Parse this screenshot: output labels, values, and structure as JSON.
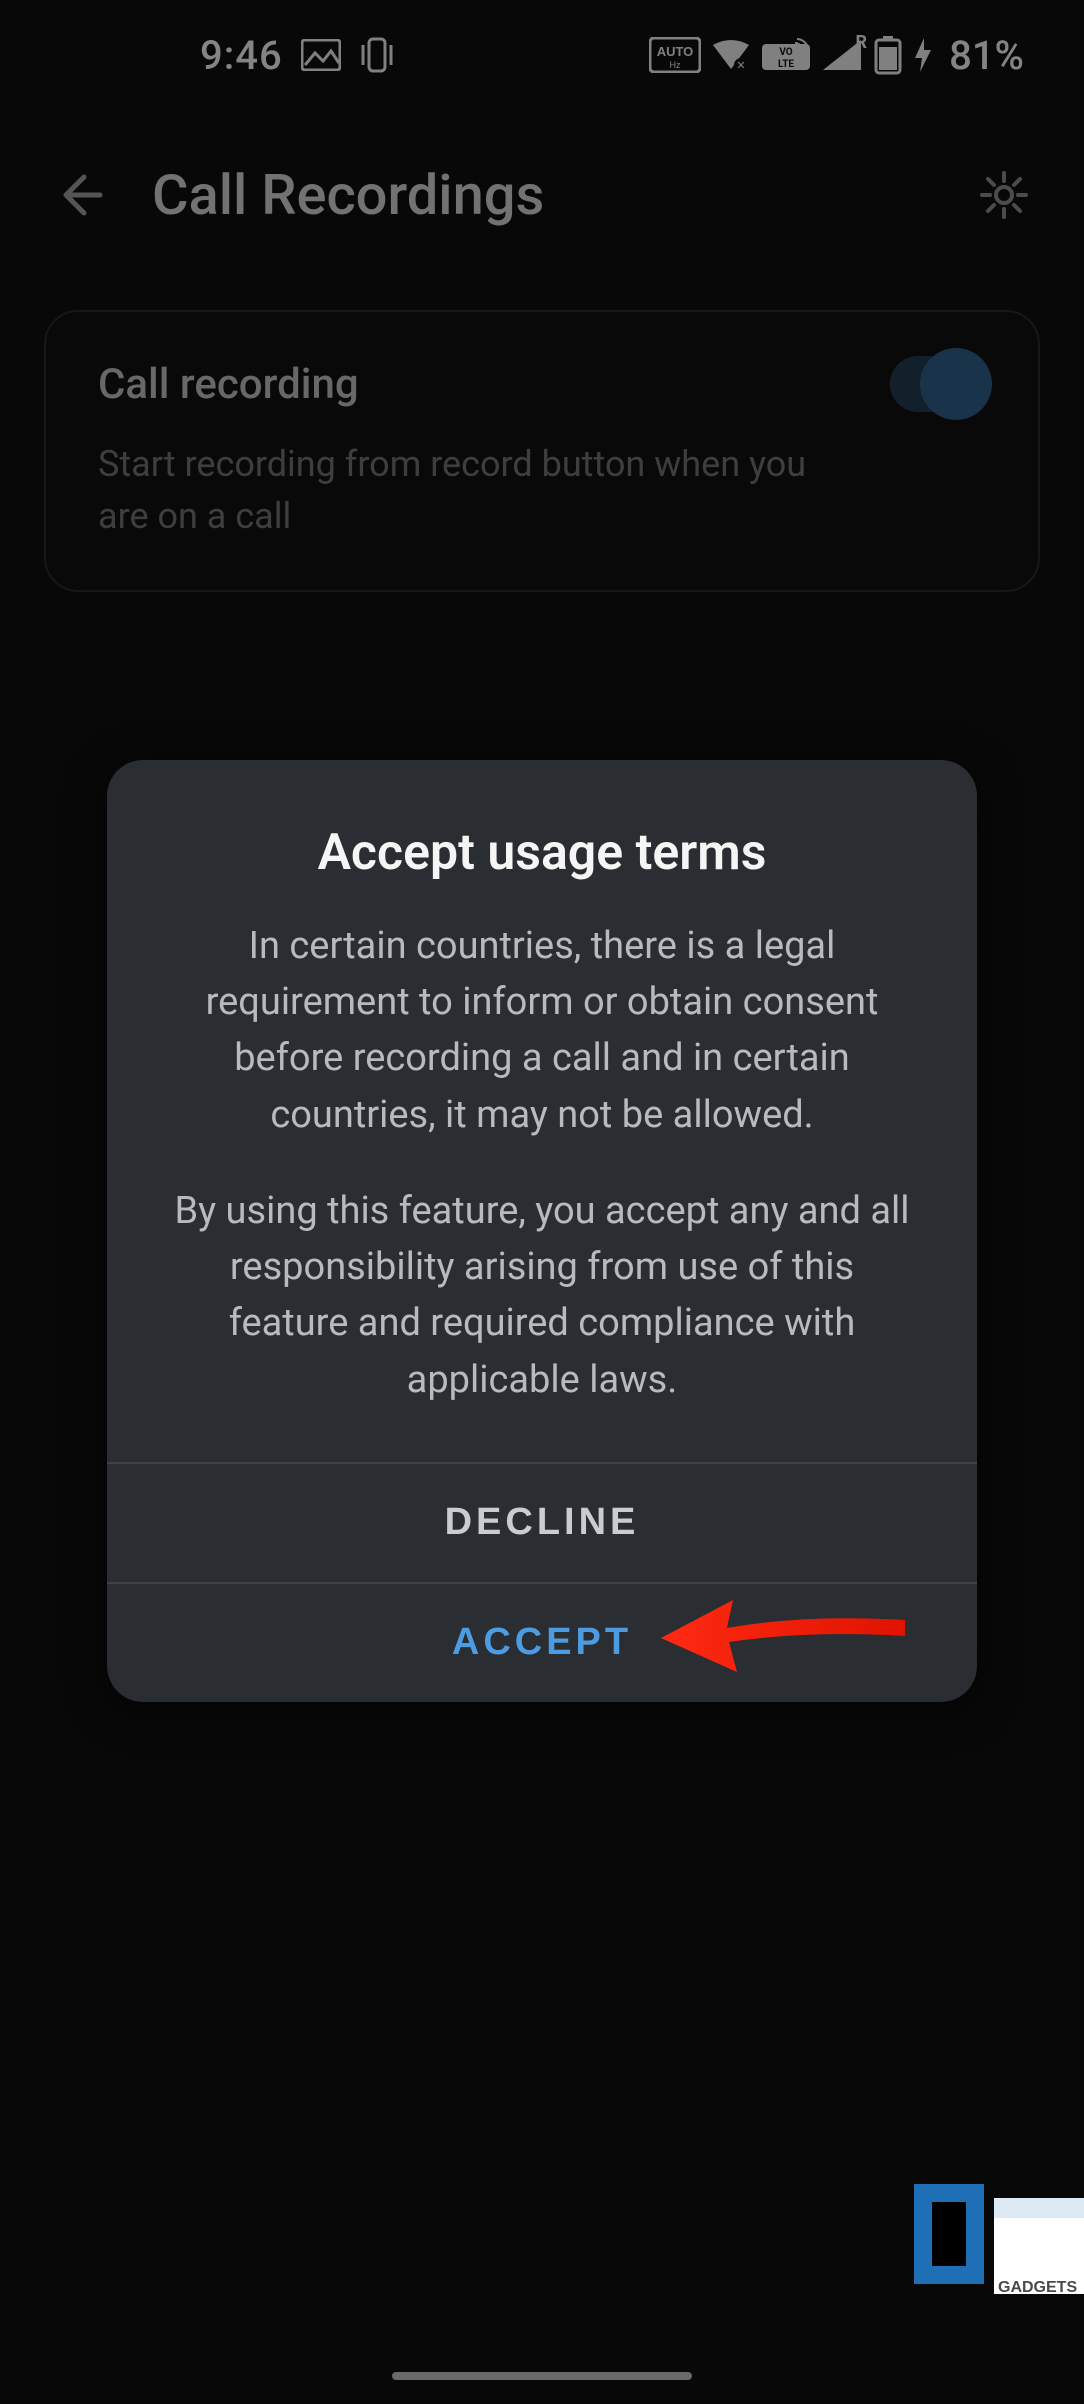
{
  "status": {
    "time": "9:46",
    "auto_hz_label": "AUTO",
    "volte_label": "VO LTE",
    "roaming_label": "R",
    "battery_pct": "81%"
  },
  "appbar": {
    "title": "Call Recordings"
  },
  "setting": {
    "title": "Call recording",
    "description": "Start recording from record button when you are on a call",
    "toggle_on": true
  },
  "modal": {
    "title": "Accept usage terms",
    "para1": "In certain countries, there is a legal requirement to inform or obtain consent before recording a call and in certain countries, it may not be allowed.",
    "para2": "By using this feature, you accept any and all responsibility arising from use of this feature and required compliance with applicable laws.",
    "decline_label": "DECLINE",
    "accept_label": "ACCEPT"
  }
}
